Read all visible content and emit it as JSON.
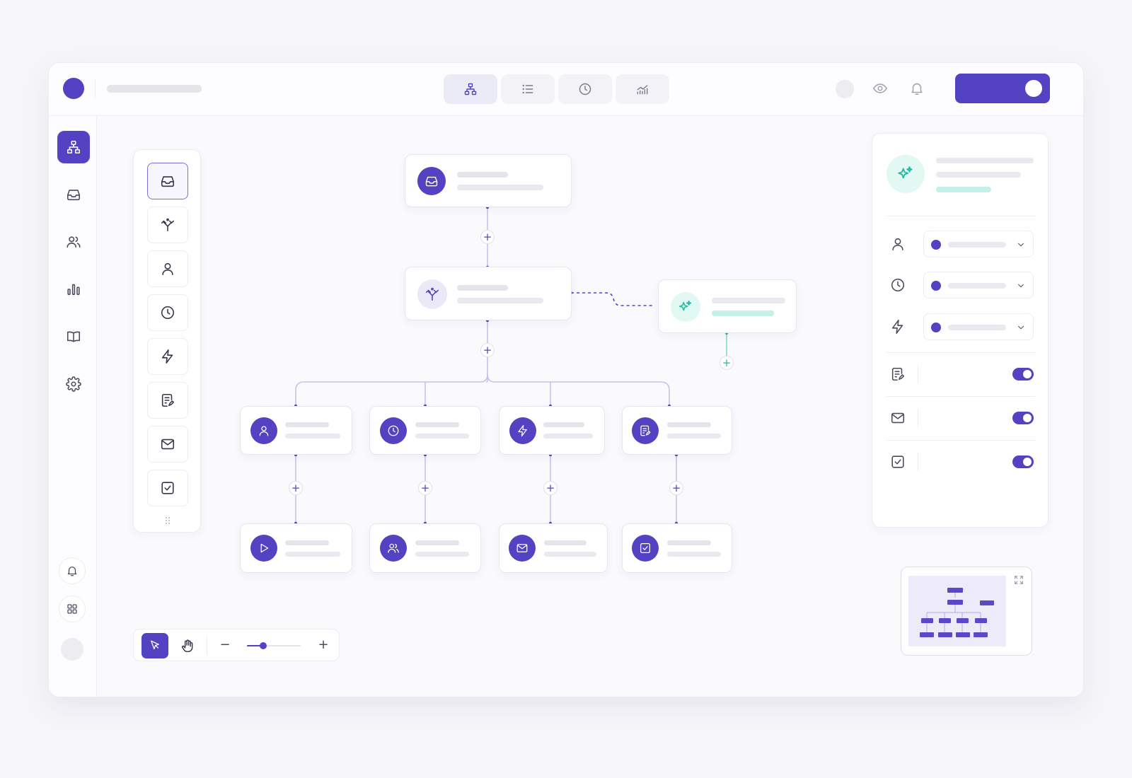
{
  "app": {
    "accent_color": "#5342c2",
    "secondary_accent_color": "#22bba0",
    "logo_icon": "app-logo-circle"
  },
  "topbar": {
    "view_tabs": [
      {
        "icon": "flow-tree-icon",
        "active": true
      },
      {
        "icon": "list-icon",
        "active": false
      },
      {
        "icon": "clock-icon",
        "active": false
      },
      {
        "icon": "analytics-icon",
        "active": false
      }
    ],
    "actions": [
      "user-avatar",
      "eye-icon",
      "bell-icon"
    ],
    "publish_toggle": {
      "state": "on"
    }
  },
  "sidebar": {
    "items": [
      {
        "icon": "workflow-icon",
        "active": true
      },
      {
        "icon": "inbox-icon",
        "active": false
      },
      {
        "icon": "users-icon",
        "active": false
      },
      {
        "icon": "bar-chart-icon",
        "active": false
      },
      {
        "icon": "book-icon",
        "active": false
      },
      {
        "icon": "gear-icon",
        "active": false
      }
    ],
    "bottom": [
      "bell-icon",
      "apps-grid-icon",
      "user-avatar"
    ]
  },
  "palette": {
    "items": [
      "inbox-icon",
      "split-icon",
      "user-icon",
      "clock-icon",
      "lightning-icon",
      "form-icon",
      "mail-icon",
      "checkbox-icon"
    ],
    "selected": "inbox-icon"
  },
  "canvas": {
    "nodes": [
      {
        "id": "trigger",
        "icon": "inbox-icon",
        "style": "solid"
      },
      {
        "id": "split",
        "icon": "split-icon",
        "style": "soft"
      },
      {
        "id": "ai",
        "icon": "sparkle-icon",
        "style": "teal"
      },
      {
        "id": "assign",
        "icon": "user-icon",
        "style": "solid"
      },
      {
        "id": "delay",
        "icon": "clock-icon",
        "style": "solid"
      },
      {
        "id": "action",
        "icon": "lightning-icon",
        "style": "solid"
      },
      {
        "id": "form",
        "icon": "form-icon",
        "style": "solid"
      },
      {
        "id": "run",
        "icon": "play-icon",
        "style": "solid"
      },
      {
        "id": "team",
        "icon": "users-icon",
        "style": "solid"
      },
      {
        "id": "email",
        "icon": "mail-icon",
        "style": "solid"
      },
      {
        "id": "approve",
        "icon": "checkbox-icon",
        "style": "solid"
      }
    ],
    "add_step_symbol": "+"
  },
  "inspector": {
    "header_icon": "sparkle-icon",
    "dropdown_rows": [
      "user-icon",
      "clock-icon",
      "lightning-icon"
    ],
    "toggle_rows": [
      {
        "icon": "form-icon",
        "enabled": true
      },
      {
        "icon": "mail-icon",
        "enabled": true
      },
      {
        "icon": "checkbox-icon",
        "enabled": true
      }
    ]
  },
  "toolbar": {
    "tools": [
      "pointer-icon",
      "hand-icon"
    ],
    "active_tool": "pointer-icon",
    "zoom_out": "−",
    "zoom_in": "+",
    "zoom_level": 0.3
  },
  "minimap": {
    "expand_icon": "expand-icon"
  }
}
